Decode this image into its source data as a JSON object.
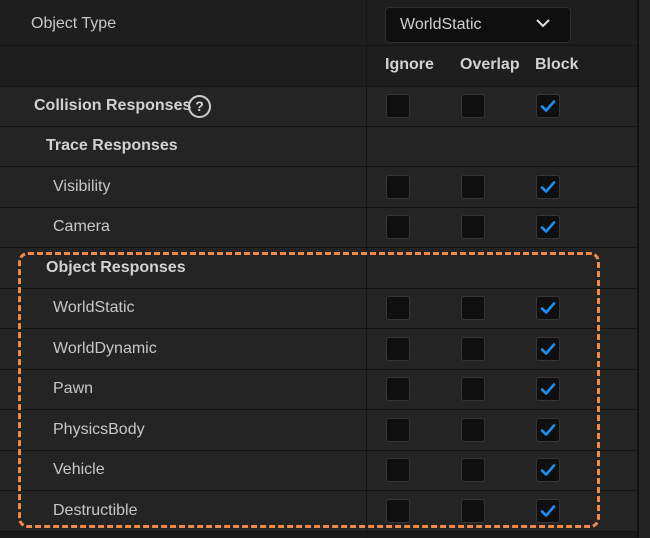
{
  "object_type": {
    "label": "Object Type",
    "value": "WorldStatic"
  },
  "columns": {
    "ignore": "Ignore",
    "overlap": "Overlap",
    "block": "Block"
  },
  "collision_responses": {
    "label": "Collision Responses",
    "help_glyph": "?",
    "ignore": false,
    "overlap": false,
    "block": true
  },
  "trace_responses": {
    "label": "Trace Responses",
    "items": [
      {
        "label": "Visibility",
        "ignore": false,
        "overlap": false,
        "block": true
      },
      {
        "label": "Camera",
        "ignore": false,
        "overlap": false,
        "block": true
      }
    ]
  },
  "object_responses": {
    "label": "Object Responses",
    "items": [
      {
        "label": "WorldStatic",
        "ignore": false,
        "overlap": false,
        "block": true
      },
      {
        "label": "WorldDynamic",
        "ignore": false,
        "overlap": false,
        "block": true
      },
      {
        "label": "Pawn",
        "ignore": false,
        "overlap": false,
        "block": true
      },
      {
        "label": "PhysicsBody",
        "ignore": false,
        "overlap": false,
        "block": true
      },
      {
        "label": "Vehicle",
        "ignore": false,
        "overlap": false,
        "block": true
      },
      {
        "label": "Destructible",
        "ignore": false,
        "overlap": false,
        "block": true
      }
    ]
  },
  "colors": {
    "check": "#1f8cf0",
    "highlight": "#f08a4b"
  }
}
